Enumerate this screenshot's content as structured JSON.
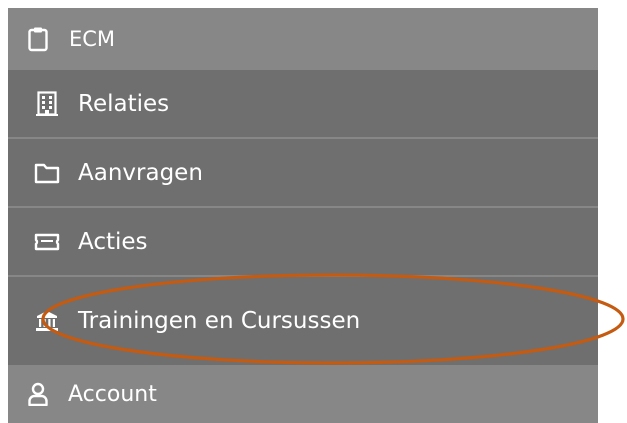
{
  "menu": {
    "header": {
      "label": "ECM",
      "icon": "clipboard-icon"
    },
    "items": [
      {
        "label": "Relaties",
        "icon": "building-icon"
      },
      {
        "label": "Aanvragen",
        "icon": "folder-icon"
      },
      {
        "label": "Acties",
        "icon": "ticket-icon"
      },
      {
        "label": "Trainingen en Cursussen",
        "icon": "bank-icon"
      }
    ],
    "account": {
      "label": "Account",
      "icon": "user-icon"
    }
  },
  "colors": {
    "header_bg": "#878787",
    "item_bg": "#6f6f6f",
    "text": "#ffffff",
    "annotation": "#c55a11"
  }
}
